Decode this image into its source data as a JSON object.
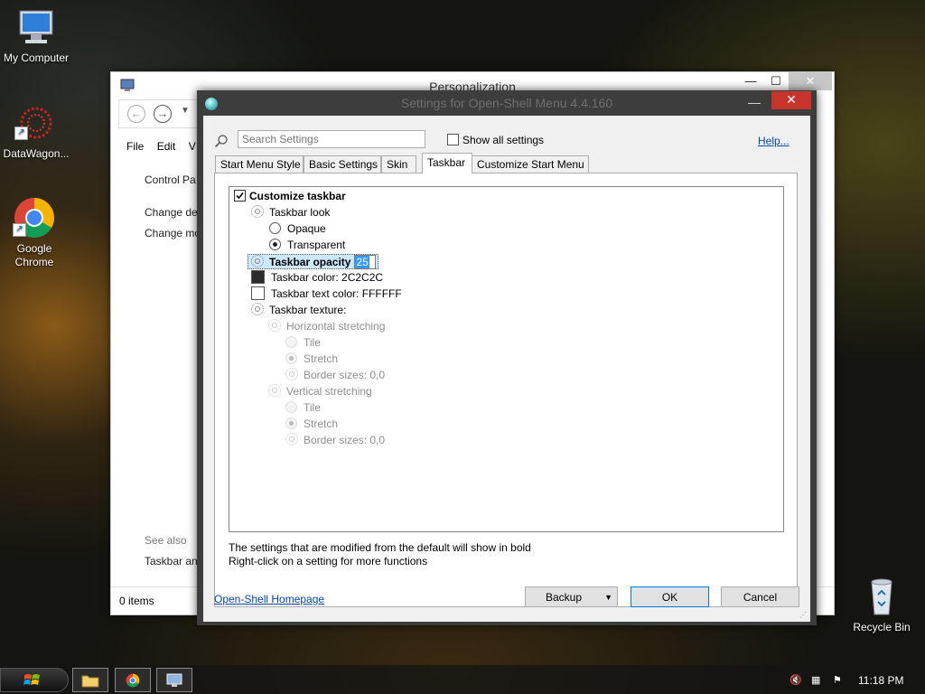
{
  "desktop": {
    "icons": [
      {
        "label": "My Computer"
      },
      {
        "label": "DataWagon..."
      },
      {
        "label1": "Google",
        "label2": "Chrome"
      },
      {
        "label": "Recycle Bin"
      }
    ]
  },
  "cp_window": {
    "title": "Personalization",
    "menu": [
      "File",
      "Edit",
      "V"
    ],
    "left_links": [
      "Control Pa",
      "Change de",
      "Change mo"
    ],
    "see_also": "See also",
    "taskbar_link": "Taskbar an",
    "status": "0 items"
  },
  "dialog": {
    "title": "Settings for Open-Shell Menu 4.4.160",
    "search_placeholder": "Search Settings",
    "show_all": "Show all settings",
    "help": "Help...",
    "tabs": [
      "Start Menu Style",
      "Basic Settings",
      "Skin",
      "Taskbar",
      "Customize Start Menu"
    ],
    "active_tab": "Taskbar",
    "tree": {
      "customize_taskbar": "Customize taskbar",
      "taskbar_look": "Taskbar look",
      "opaque": "Opaque",
      "transparent": "Transparent",
      "taskbar_opacity": "Taskbar opacity",
      "opacity_value": "25",
      "taskbar_color": "Taskbar color: 2C2C2C",
      "taskbar_text_color": "Taskbar text color: FFFFFF",
      "taskbar_texture": "Taskbar texture:",
      "horizontal_stretching": "Horizontal stretching",
      "h_tile": "Tile",
      "h_stretch": "Stretch",
      "h_border": "Border sizes: 0,0",
      "vertical_stretching": "Vertical stretching",
      "v_tile": "Tile",
      "v_stretch": "Stretch",
      "v_border": "Border sizes: 0,0"
    },
    "colors": {
      "taskbar_color": "#2C2C2C",
      "taskbar_text_color": "#FFFFFF"
    },
    "note1": "The settings that are modified from the default will show in bold",
    "note2": "Right-click on a setting for more functions",
    "homepage": "Open-Shell Homepage",
    "backup": "Backup",
    "ok": "OK",
    "cancel": "Cancel"
  },
  "taskbar": {
    "clock": "11:18 PM"
  }
}
